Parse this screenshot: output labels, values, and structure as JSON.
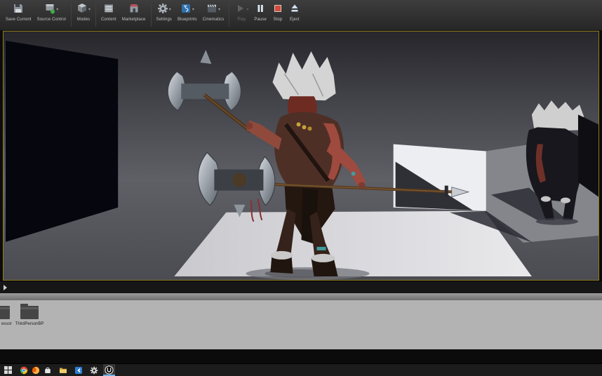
{
  "colors": {
    "viewport_border": "#8c7a1f",
    "toolbar_bg": "#2e2e2e",
    "content_browser_bg": "#b3b3b3",
    "taskbar_bg": "#1c1c1c",
    "active_task_underline": "#6fb3e8"
  },
  "toolbar": {
    "caret": "▾",
    "buttons": [
      {
        "label": "Save Current"
      },
      {
        "label": "Source Control"
      },
      {
        "label": "Modes"
      },
      {
        "label": "Content"
      },
      {
        "label": "Marketplace"
      },
      {
        "label": "Settings"
      },
      {
        "label": "Blueprints"
      },
      {
        "label": "Cinematics"
      },
      {
        "label": "Play"
      },
      {
        "label": "Pause"
      },
      {
        "label": "Stop"
      },
      {
        "label": "Eject"
      }
    ]
  },
  "viewport": {
    "scene": "Third-person barbarian character holding axes and a spear in a grey-box level"
  },
  "content_browser": {
    "folders": [
      {
        "label": "essor"
      },
      {
        "label": "ThirdPersonBP"
      }
    ]
  },
  "taskbar": {
    "icons": [
      "start",
      "chrome",
      "firefox",
      "store",
      "file-explorer",
      "code",
      "settings",
      "unreal-engine"
    ],
    "active": "unreal-engine"
  }
}
